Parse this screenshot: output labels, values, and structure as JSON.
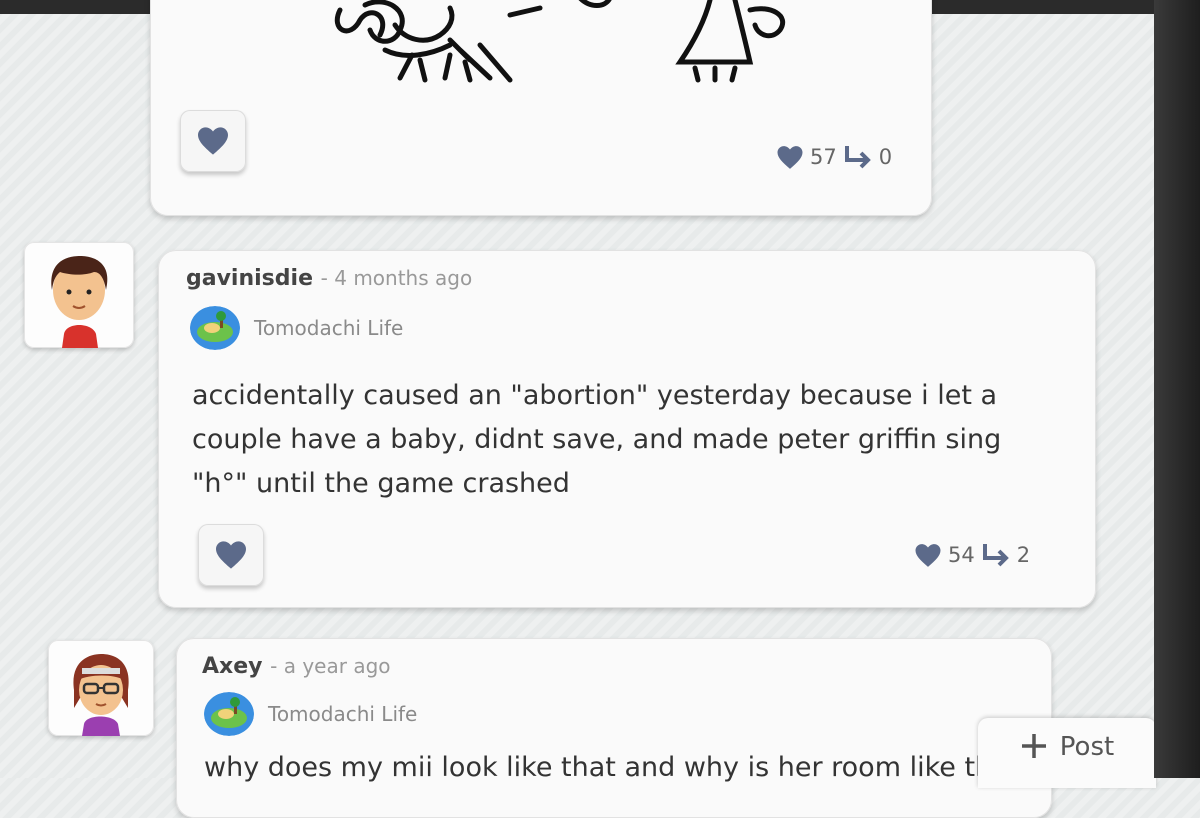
{
  "posts": [
    {
      "likes": "57",
      "replies": "0"
    },
    {
      "username": "gavinisdie",
      "timestamp": "- 4 months ago",
      "game": "Tomodachi Life",
      "text_lines": [
        "accidentally caused an \"abortion\" yesterday because i let a",
        "couple have a baby, didnt save, and made peter griffin sing",
        "\"h°\" until the game crashed"
      ],
      "likes": "54",
      "replies": "2"
    },
    {
      "username": "Axey",
      "timestamp": "- a year ago",
      "game": "Tomodachi Life",
      "text_lines": [
        "why does my mii look like that and why is her room like tl"
      ]
    }
  ],
  "post_button": {
    "icon": "plus-icon",
    "label": "Post"
  },
  "colors": {
    "heart": "#5c6a8a",
    "text": "#333333"
  }
}
